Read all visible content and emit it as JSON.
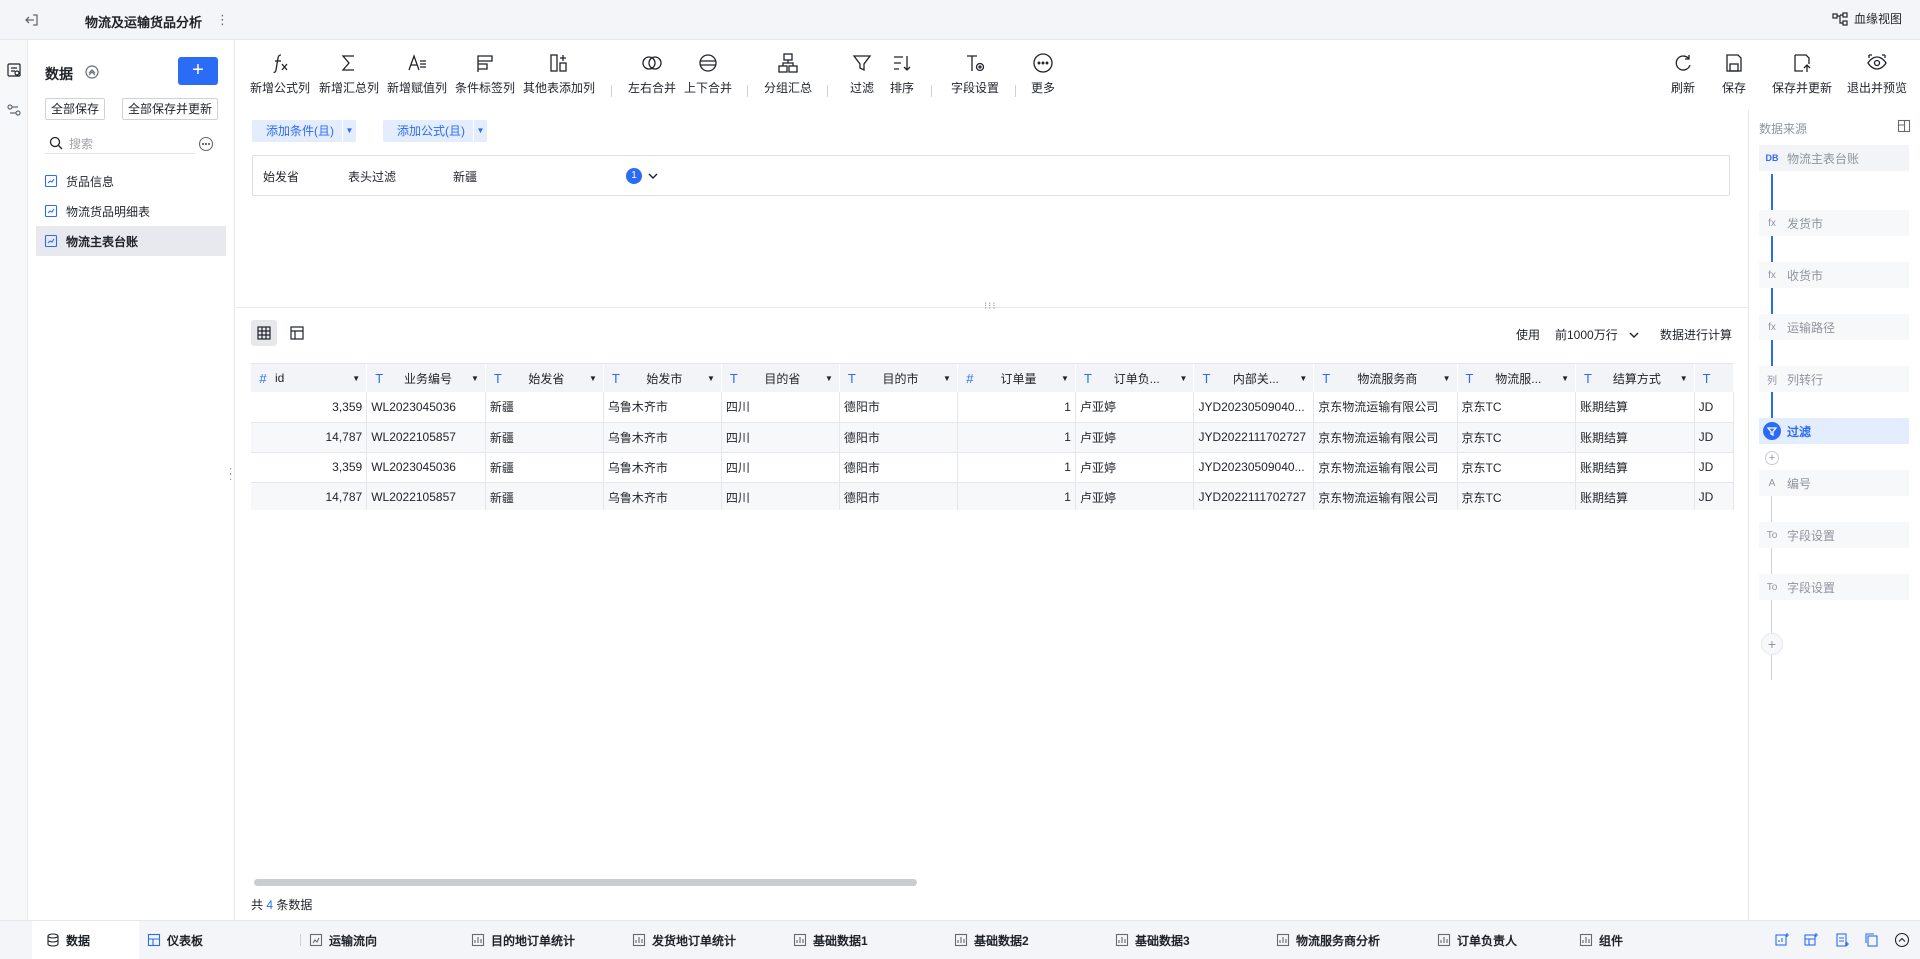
{
  "header": {
    "title": "物流及运输货品分析",
    "more_label": "⋮",
    "lineage_label": "血缘视图"
  },
  "data_panel": {
    "title": "数据",
    "add_label": "+",
    "save_all": "全部保存",
    "save_all_update": "全部保存并更新",
    "search_placeholder": "搜索",
    "items": [
      {
        "label": "货品信息",
        "active": false
      },
      {
        "label": "物流货品明细表",
        "active": false
      },
      {
        "label": "物流主表台账",
        "active": true
      }
    ]
  },
  "toolbar": {
    "left": [
      {
        "label": "新增公式列",
        "icon": "formula-icon"
      },
      {
        "label": "新增汇总列",
        "icon": "sigma-icon"
      },
      {
        "label": "新增赋值列",
        "icon": "assign-icon"
      },
      {
        "label": "条件标签列",
        "icon": "tag-icon"
      },
      {
        "label": "其他表添加列",
        "icon": "add-column-icon"
      },
      {
        "label": "左右合并",
        "icon": "merge-horizontal-icon"
      },
      {
        "label": "上下合并",
        "icon": "merge-vertical-icon"
      },
      {
        "label": "分组汇总",
        "icon": "group-icon"
      },
      {
        "label": "过滤",
        "icon": "filter-icon"
      },
      {
        "label": "排序",
        "icon": "sort-icon"
      },
      {
        "label": "字段设置",
        "icon": "field-settings-icon"
      },
      {
        "label": "更多",
        "icon": "more-icon"
      }
    ],
    "right": [
      {
        "label": "刷新",
        "icon": "refresh-icon"
      },
      {
        "label": "保存",
        "icon": "save-icon"
      },
      {
        "label": "保存并更新",
        "icon": "save-update-icon"
      },
      {
        "label": "退出并预览",
        "icon": "preview-icon"
      }
    ]
  },
  "filter": {
    "add_condition": "添加条件(且)",
    "add_formula": "添加公式(且)",
    "condition": {
      "field": "始发省",
      "type": "表头过滤",
      "value": "新疆",
      "count": "1"
    }
  },
  "view": {
    "limit_prefix": "使用",
    "limit_value": "前1000万行",
    "limit_suffix": "数据进行计算"
  },
  "table": {
    "columns": [
      {
        "name": "id",
        "type": "#"
      },
      {
        "name": "业务编号",
        "type": "T"
      },
      {
        "name": "始发省",
        "type": "T"
      },
      {
        "name": "始发市",
        "type": "T"
      },
      {
        "name": "目的省",
        "type": "T"
      },
      {
        "name": "目的市",
        "type": "T"
      },
      {
        "name": "订单量",
        "type": "#"
      },
      {
        "name": "订单负...",
        "type": "T"
      },
      {
        "name": "内部关...",
        "type": "T"
      },
      {
        "name": "物流服务商",
        "type": "T"
      },
      {
        "name": "物流服...",
        "type": "T"
      },
      {
        "name": "结算方式",
        "type": "T"
      },
      {
        "name": "",
        "type": "T"
      }
    ],
    "rows": [
      [
        "3,359",
        "WL2023045036",
        "新疆",
        "乌鲁木齐市",
        "四川",
        "德阳市",
        "1",
        "卢亚婷",
        "JYD20230509040...",
        "京东物流运输有限公司",
        "京东TC",
        "账期结算",
        "JD"
      ],
      [
        "14,787",
        "WL2022105857",
        "新疆",
        "乌鲁木齐市",
        "四川",
        "德阳市",
        "1",
        "卢亚婷",
        "JYD2022111702727",
        "京东物流运输有限公司",
        "京东TC",
        "账期结算",
        "JD"
      ],
      [
        "3,359",
        "WL2023045036",
        "新疆",
        "乌鲁木齐市",
        "四川",
        "德阳市",
        "1",
        "卢亚婷",
        "JYD20230509040...",
        "京东物流运输有限公司",
        "京东TC",
        "账期结算",
        "JD"
      ],
      [
        "14,787",
        "WL2022105857",
        "新疆",
        "乌鲁木齐市",
        "四川",
        "德阳市",
        "1",
        "卢亚婷",
        "JYD2022111702727",
        "京东物流运输有限公司",
        "京东TC",
        "账期结算",
        "JD"
      ]
    ],
    "count_prefix": "共",
    "count_value": "4",
    "count_suffix": "条数据"
  },
  "right_panel": {
    "title": "数据来源",
    "nodes": [
      {
        "label": "物流主表台账",
        "icon": "DB",
        "kind": "src"
      },
      {
        "label": "发货市",
        "icon": "fx",
        "kind": "dim"
      },
      {
        "label": "收货市",
        "icon": "fx",
        "kind": "dim"
      },
      {
        "label": "运输路径",
        "icon": "fx",
        "kind": "dim"
      },
      {
        "label": "列转行",
        "icon": "列",
        "kind": "dim"
      },
      {
        "label": "过滤",
        "icon": "filter",
        "kind": "act"
      },
      {
        "label": "编号",
        "icon": "A",
        "kind": "dim"
      },
      {
        "label": "字段设置",
        "icon": "To",
        "kind": "dim"
      },
      {
        "label": "字段设置",
        "icon": "To",
        "kind": "dim"
      }
    ]
  },
  "bottom_tabs": [
    {
      "label": "数据",
      "icon": "database-icon",
      "active": true
    },
    {
      "label": "仪表板",
      "icon": "dashboard-icon",
      "active": false
    },
    {
      "label": "运输流向",
      "icon": "chart-icon",
      "active": false
    },
    {
      "label": "目的地订单统计",
      "icon": "chart-icon",
      "active": false
    },
    {
      "label": "发货地订单统计",
      "icon": "chart-icon",
      "active": false
    },
    {
      "label": "基础数据1",
      "icon": "chart-icon",
      "active": false
    },
    {
      "label": "基础数据2",
      "icon": "chart-icon",
      "active": false
    },
    {
      "label": "基础数据3",
      "icon": "chart-icon",
      "active": false
    },
    {
      "label": "物流服务商分析",
      "icon": "chart-icon",
      "active": false
    },
    {
      "label": "订单负责人",
      "icon": "chart-icon",
      "active": false
    },
    {
      "label": "组件",
      "icon": "component-icon",
      "active": false
    }
  ],
  "colors": {
    "accent": "#2b6cf6",
    "header_bg": "#f3f5f8",
    "table_header_bg": "#f2f4f7"
  }
}
